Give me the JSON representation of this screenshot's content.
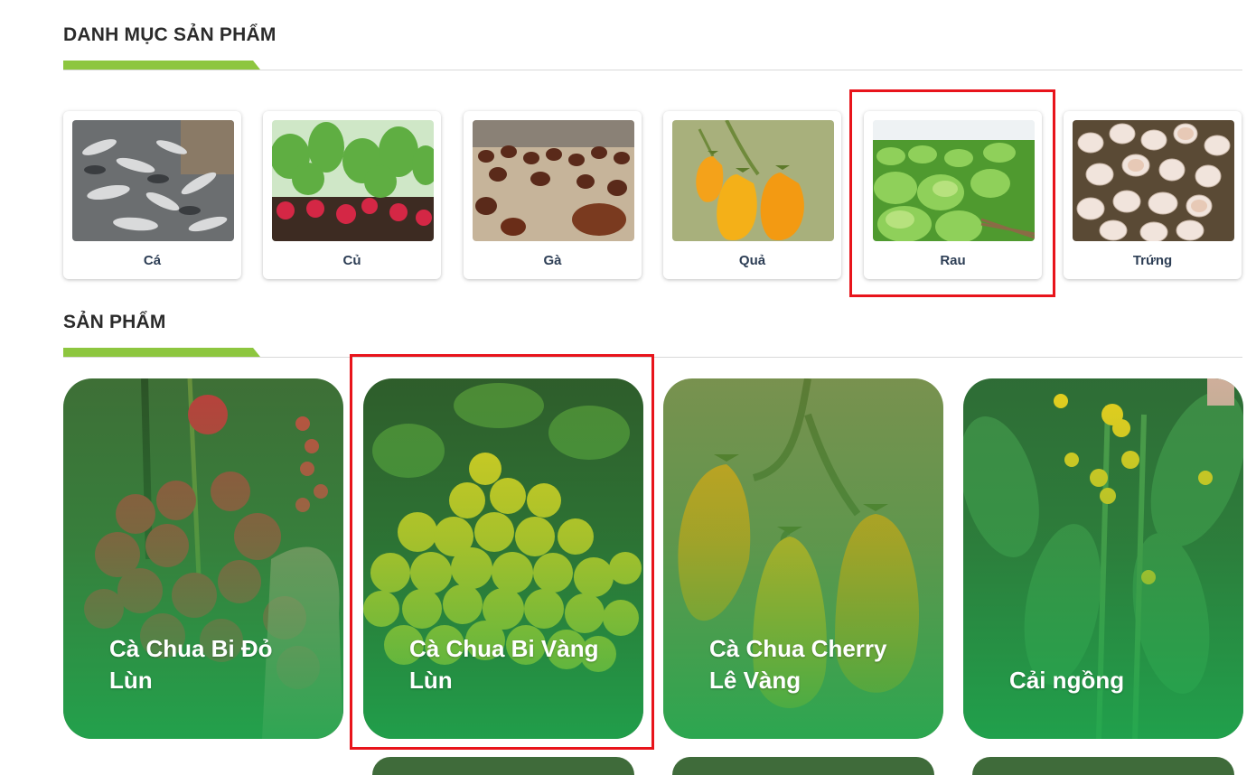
{
  "categories_section": {
    "title": "DANH MỤC SẢN PHẨM",
    "items": [
      {
        "label": "Cá",
        "image": "fish-pond-photo"
      },
      {
        "label": "Củ",
        "image": "radish-photo"
      },
      {
        "label": "Gà",
        "image": "chickens-photo"
      },
      {
        "label": "Quả",
        "image": "yellow-pear-tomato-photo"
      },
      {
        "label": "Rau",
        "image": "leafy-greens-photo"
      },
      {
        "label": "Trứng",
        "image": "eggs-photo"
      }
    ]
  },
  "products_section": {
    "title": "SẢN PHẨM",
    "items": [
      {
        "name": "Cà Chua Bi Đỏ Lùn",
        "image": "red-cherry-tomato-photo"
      },
      {
        "name": "Cà Chua Bi Vàng Lùn",
        "image": "yellow-cherry-tomato-photo"
      },
      {
        "name": "Cà Chua Cherry Lê Vàng",
        "image": "yellow-pear-tomato-photo"
      },
      {
        "name": "Cải ngồng",
        "image": "flowering-choy-sum-photo"
      }
    ]
  },
  "colors": {
    "accent_green": "#8dc63f",
    "card_green_overlay": "#1eaa50",
    "highlight_red": "#e8141b",
    "label_text": "#2d3e55"
  }
}
